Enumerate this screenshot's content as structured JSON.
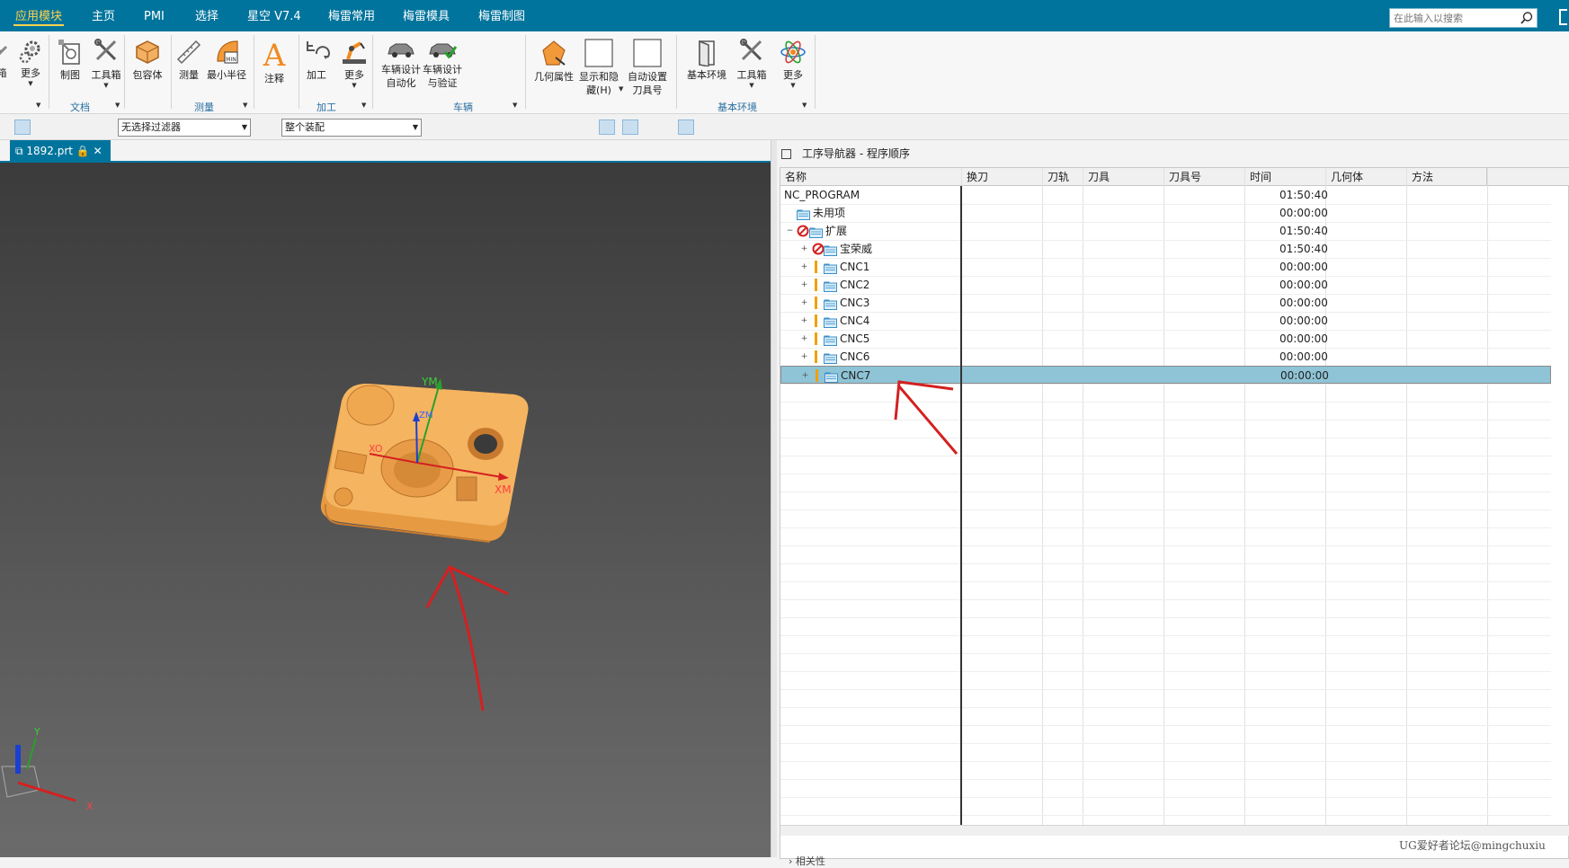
{
  "menubar": {
    "tabs": [
      {
        "label": "应用模块",
        "active": true
      },
      {
        "label": "主页"
      },
      {
        "label": "PMI"
      },
      {
        "label": "选择"
      },
      {
        "label": "星空 V7.4"
      },
      {
        "label": "梅雷常用"
      },
      {
        "label": "梅雷模具"
      },
      {
        "label": "梅雷制图"
      }
    ],
    "search_placeholder": "在此输入以搜索"
  },
  "ribbon": {
    "buttons": {
      "partial": "箱",
      "more1": "更多",
      "drafting": "制图",
      "toolbox1": "工具箱",
      "bbox": "包容体",
      "measure": "测量",
      "min_radius": "最小半径",
      "annotate": "注释",
      "machining": "加工",
      "more2": "更多",
      "veh_auto_1": "车辆设计",
      "veh_auto_2": "自动化",
      "veh_verify_1": "车辆设计",
      "veh_verify_2": "与验证",
      "geom_prop": "几何属性",
      "show_hide_1": "显示和隐",
      "show_hide_2": "藏(H)",
      "auto_tool_1": "自动设置",
      "auto_tool_2": "刀具号",
      "base_env": "基本环境",
      "toolbox2": "工具箱",
      "more3": "更多"
    },
    "groups": {
      "doc": "文档",
      "measure": "测量",
      "machining": "加工",
      "vehicle": "车辆",
      "base": "基本环境"
    }
  },
  "toolbar2": {
    "filter": "无选择过滤器",
    "assembly": "整个装配"
  },
  "file_tab": {
    "label": "1892.prt"
  },
  "viewport": {
    "wcs_x": "XM",
    "wcs_y": "YM",
    "wcs_x2": "XO",
    "wcs_z": "ZM",
    "triad_x": "X",
    "triad_y": "Y",
    "model_color": "#f0a850",
    "annotation_color": "#d42020"
  },
  "navigator": {
    "title": "工序导航器 - 程序顺序",
    "columns": [
      "名称",
      "换刀",
      "刀轨",
      "刀具",
      "刀具号",
      "时间",
      "几何体",
      "方法"
    ],
    "rows": [
      {
        "name": "NC_PROGRAM",
        "time": "01:50:40"
      },
      {
        "name": "未用项",
        "time": "00:00:00"
      },
      {
        "name": "扩展",
        "time": "01:50:40"
      },
      {
        "name": "宝荣威",
        "time": "01:50:40"
      },
      {
        "name": "CNC1",
        "time": "00:00:00"
      },
      {
        "name": "CNC2",
        "time": "00:00:00"
      },
      {
        "name": "CNC3",
        "time": "00:00:00"
      },
      {
        "name": "CNC4",
        "time": "00:00:00"
      },
      {
        "name": "CNC5",
        "time": "00:00:00"
      },
      {
        "name": "CNC6",
        "time": "00:00:00"
      },
      {
        "name": "CNC7",
        "time": "00:00:00",
        "selected": true
      }
    ],
    "bottom_label": "相关性"
  },
  "watermark": "UG爱好者论坛@mingchuxiu"
}
